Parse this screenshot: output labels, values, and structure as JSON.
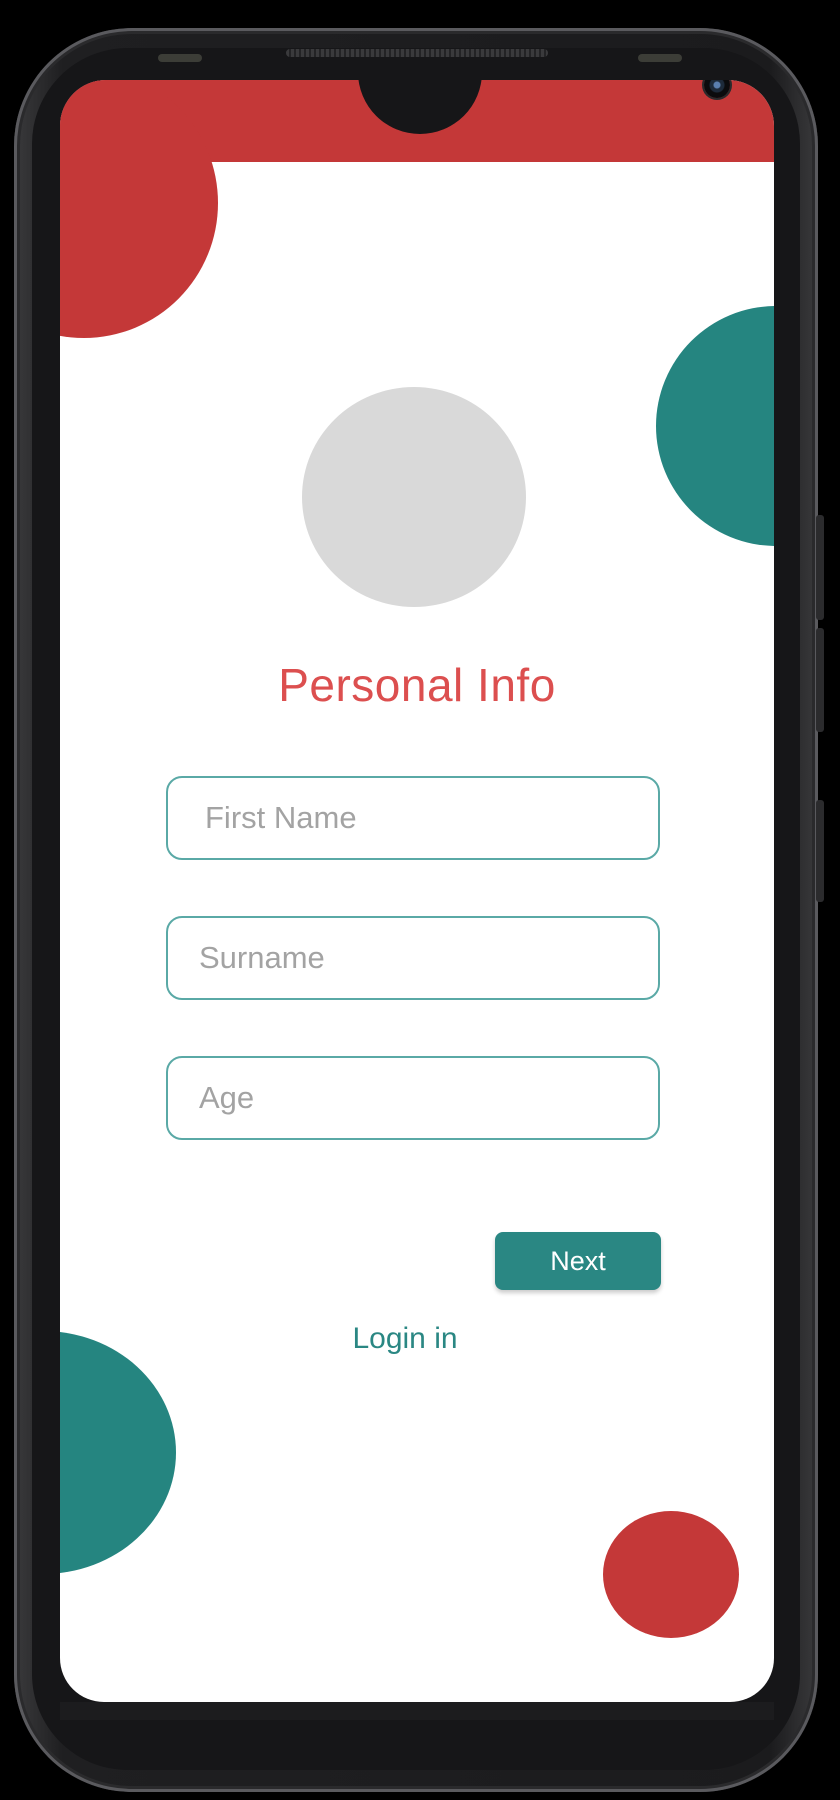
{
  "app": {
    "title": "Personal Info"
  },
  "form": {
    "fields": [
      {
        "name": "first_name",
        "placeholder": "First Name",
        "value": ""
      },
      {
        "name": "surname",
        "placeholder": "Surname",
        "value": ""
      },
      {
        "name": "age",
        "placeholder": "Age",
        "value": ""
      }
    ],
    "next_label": "Next",
    "login_label": "Login in"
  },
  "theme": {
    "primary_red": "#c43838",
    "title_red": "#dc4f4f",
    "primary_teal": "#258580",
    "field_border": "#5aa9a6",
    "avatar_placeholder": "#d9d9d9"
  },
  "icons": {
    "camera": "front-camera-icon"
  }
}
